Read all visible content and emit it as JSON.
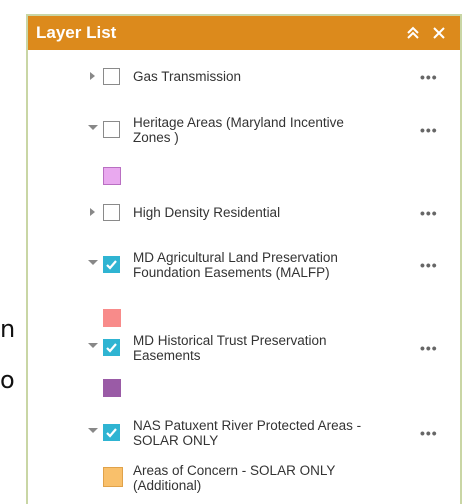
{
  "background": {
    "line1": "n",
    "line2": "o"
  },
  "panel": {
    "title": "Layer List",
    "collapse_icon": "double-chevron-up-icon",
    "close_icon": "close-icon",
    "header_color": "#dc8a1c"
  },
  "layers": [
    {
      "label": "Gas Transmission",
      "checked": false,
      "expanded": false,
      "more": "•••"
    },
    {
      "label": "Heritage Areas (Maryland Incentive Zones )",
      "checked": false,
      "expanded": true,
      "more": "•••",
      "swatch_color": "#e9a9ef"
    },
    {
      "label": "High Density Residential",
      "checked": false,
      "expanded": false,
      "more": "•••"
    },
    {
      "label": "MD Agricultural Land Preservation Foundation Easements (MALFP)",
      "checked": true,
      "expanded": true,
      "more": "•••",
      "swatch_color": "#f88b8a"
    },
    {
      "label": "MD Historical Trust Preservation Easements",
      "checked": true,
      "expanded": true,
      "more": "•••",
      "swatch_color": "#9a5ba6"
    },
    {
      "label": "NAS Patuxent River Protected Areas - SOLAR ONLY",
      "checked": true,
      "expanded": true,
      "more": "•••"
    }
  ],
  "legend_item": {
    "label": "Areas of Concern - SOLAR ONLY (Additional)",
    "swatch_color": "#f9c06b"
  },
  "colors": {
    "checkbox_on": "#2fb4d2",
    "panel_border": "#c9d6a5"
  }
}
